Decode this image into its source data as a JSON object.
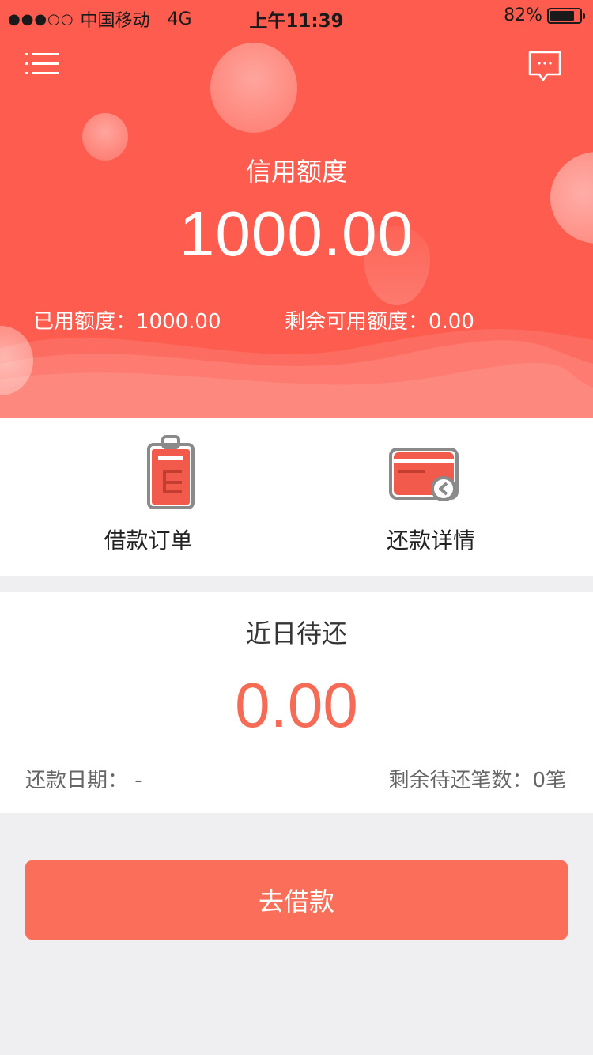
{
  "status_bar": {
    "signal": "●●●○○",
    "carrier": "中国移动",
    "network": "4G",
    "time": "上午11:39",
    "battery": "82%"
  },
  "header": {
    "credit_title": "信用额度",
    "credit_amount": "1000.00",
    "used_label": "已用额度：1000.00",
    "remaining_label": "剩余可用额度：0.00"
  },
  "shortcuts": {
    "loan_orders_label": "借款订单",
    "repay_details_label": "还款详情"
  },
  "due": {
    "title": "近日待还",
    "amount": "0.00",
    "date_label": "还款日期：  -",
    "count_label": "剩余待还笔数：0笔"
  },
  "actions": {
    "borrow_label": "去借款"
  },
  "colors": {
    "brand": "#fd5c4e",
    "accent": "#f56b55",
    "button": "#fb6e5a"
  },
  "icons": {
    "menu": "list-menu-icon",
    "chat": "chat-bubble-icon",
    "loan_orders": "clipboard-icon",
    "repay_details": "card-refund-icon"
  }
}
